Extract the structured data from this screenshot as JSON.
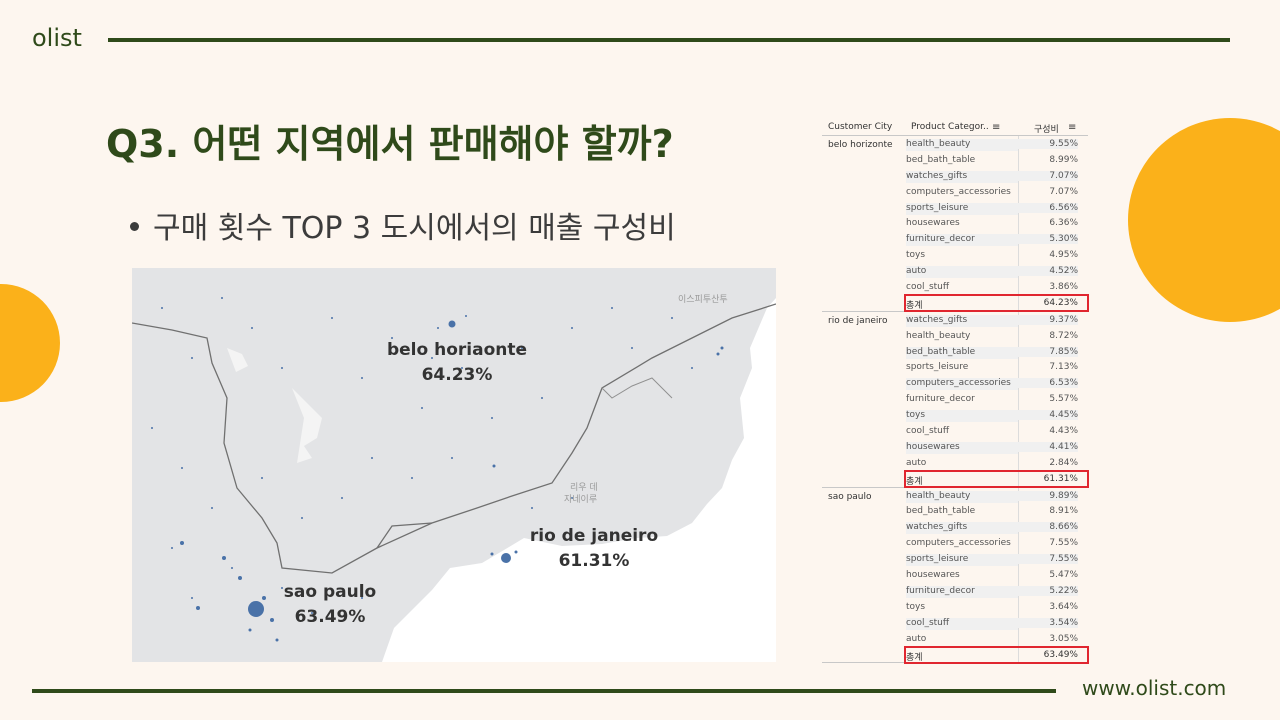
{
  "header": {
    "brand": "olist"
  },
  "footer": {
    "url": "www.olist.com"
  },
  "slide": {
    "title": "Q3. 어떤 지역에서 판매해야 할까?",
    "bullet": "구매 횟수 TOP 3 도시에서의 매출 구성비"
  },
  "map": {
    "place_labels": [
      "이스피투산투",
      "리우 데",
      "자네이루"
    ],
    "cities": [
      {
        "name": "belo horiaonte",
        "share": "64.23%"
      },
      {
        "name": "rio de janeiro",
        "share": "61.31%"
      },
      {
        "name": "sao paulo",
        "share": "63.49%"
      }
    ]
  },
  "table": {
    "headers": [
      "Customer City",
      "Product Categor..",
      "구성비"
    ],
    "total_label": "총계",
    "groups": [
      {
        "city": "belo horizonte",
        "rows": [
          {
            "category": "health_beauty",
            "value": "9.55%"
          },
          {
            "category": "bed_bath_table",
            "value": "8.99%"
          },
          {
            "category": "watches_gifts",
            "value": "7.07%"
          },
          {
            "category": "computers_accessories",
            "value": "7.07%"
          },
          {
            "category": "sports_leisure",
            "value": "6.56%"
          },
          {
            "category": "housewares",
            "value": "6.36%"
          },
          {
            "category": "furniture_decor",
            "value": "5.30%"
          },
          {
            "category": "toys",
            "value": "4.95%"
          },
          {
            "category": "auto",
            "value": "4.52%"
          },
          {
            "category": "cool_stuff",
            "value": "3.86%"
          }
        ],
        "total": "64.23%"
      },
      {
        "city": "rio de janeiro",
        "rows": [
          {
            "category": "watches_gifts",
            "value": "9.37%"
          },
          {
            "category": "health_beauty",
            "value": "8.72%"
          },
          {
            "category": "bed_bath_table",
            "value": "7.85%"
          },
          {
            "category": "sports_leisure",
            "value": "7.13%"
          },
          {
            "category": "computers_accessories",
            "value": "6.53%"
          },
          {
            "category": "furniture_decor",
            "value": "5.57%"
          },
          {
            "category": "toys",
            "value": "4.45%"
          },
          {
            "category": "cool_stuff",
            "value": "4.43%"
          },
          {
            "category": "housewares",
            "value": "4.41%"
          },
          {
            "category": "auto",
            "value": "2.84%"
          }
        ],
        "total": "61.31%"
      },
      {
        "city": "sao paulo",
        "rows": [
          {
            "category": "health_beauty",
            "value": "9.89%"
          },
          {
            "category": "bed_bath_table",
            "value": "8.91%"
          },
          {
            "category": "watches_gifts",
            "value": "8.66%"
          },
          {
            "category": "computers_accessories",
            "value": "7.55%"
          },
          {
            "category": "sports_leisure",
            "value": "7.55%"
          },
          {
            "category": "housewares",
            "value": "5.47%"
          },
          {
            "category": "furniture_decor",
            "value": "5.22%"
          },
          {
            "category": "toys",
            "value": "3.64%"
          },
          {
            "category": "cool_stuff",
            "value": "3.54%"
          },
          {
            "category": "auto",
            "value": "3.05%"
          }
        ],
        "total": "63.49%"
      }
    ]
  },
  "colors": {
    "brand_green": "#2f4a1a",
    "accent_orange": "#fbb11a",
    "background": "#fdf6ef",
    "highlight_red": "#e0262f",
    "map_dot": "#4a72a8"
  }
}
